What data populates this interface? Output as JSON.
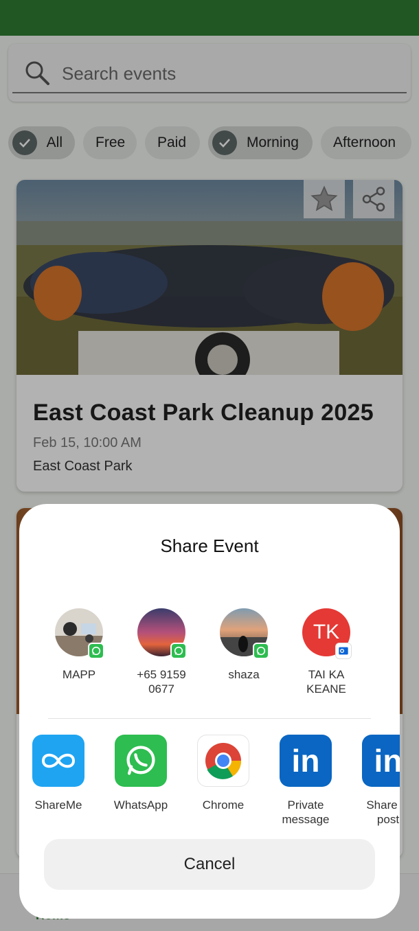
{
  "search": {
    "placeholder": "Search events"
  },
  "chips": [
    {
      "label": "All",
      "selected": true
    },
    {
      "label": "Free",
      "selected": false
    },
    {
      "label": "Paid",
      "selected": false
    },
    {
      "label": "Morning",
      "selected": true
    },
    {
      "label": "Afternoon",
      "selected": false
    }
  ],
  "event": {
    "title": "East Coast Park Cleanup 2025",
    "date": "Feb 15, 10:00 AM",
    "location": "East Coast Park"
  },
  "nav": {
    "home": "Home"
  },
  "share_sheet": {
    "title": "Share Event",
    "contacts": [
      {
        "name": "MAPP",
        "badge": "whatsapp-icon"
      },
      {
        "name": "+65 9159 0677",
        "badge": "whatsapp-icon"
      },
      {
        "name": "shaza",
        "badge": "whatsapp-icon"
      },
      {
        "name": "TAI KA KEANE",
        "initials": "TK",
        "badge": "outlook-icon"
      }
    ],
    "apps": [
      {
        "name": "ShareMe",
        "icon": "shareme-icon"
      },
      {
        "name": "WhatsApp",
        "icon": "whatsapp-icon"
      },
      {
        "name": "Chrome",
        "icon": "chrome-icon"
      },
      {
        "name": "Private message",
        "icon": "linkedin-icon"
      },
      {
        "name": "Share in post",
        "icon": "linkedin-icon"
      }
    ],
    "cancel": "Cancel"
  },
  "colors": {
    "topbar": "#2e7d32",
    "whatsapp": "#2dbd50",
    "linkedin": "#0a66c2",
    "avatar_tk": "#e53935"
  }
}
